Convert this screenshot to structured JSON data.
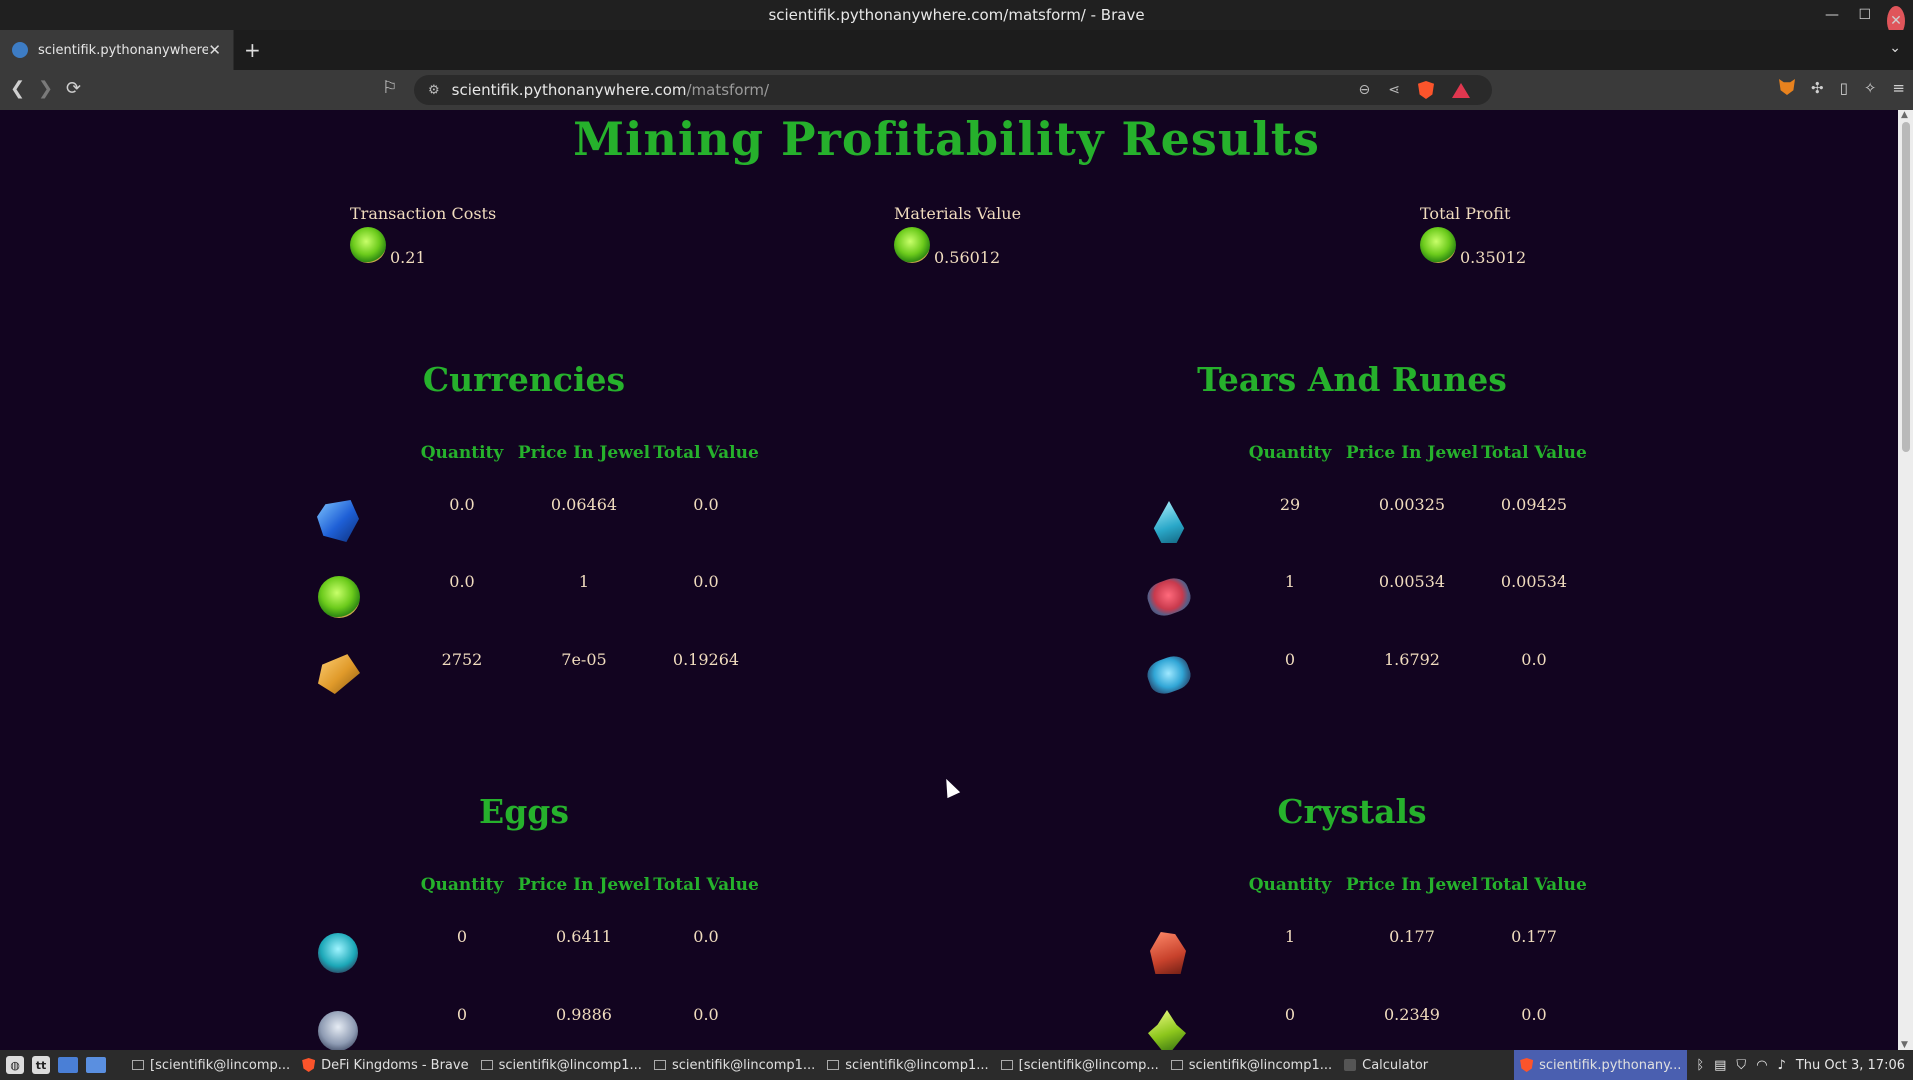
{
  "window": {
    "title": "scientifik.pythonanywhere.com/matsform/ - Brave",
    "min": "—",
    "max": "☐",
    "close": "✕"
  },
  "tabs": [
    {
      "title": "scientifik.pythonanywhere.c",
      "close": "✕"
    }
  ],
  "tabstrip": {
    "new_tab": "+",
    "menu": "⌄"
  },
  "toolbar": {
    "back": "❮",
    "forward": "❯",
    "reload": "⟳",
    "bookmark": "⚐",
    "site_info": "⚙",
    "url_host": "scientifik.pythonanywhere.com",
    "url_path": "/matsform/",
    "zoom": "⊖",
    "share": "⋖",
    "sidebar": "▯",
    "leo": "✧",
    "menu": "≡",
    "extensions": "✣"
  },
  "page": {
    "title": "Mining Profitability Results",
    "summary": [
      {
        "label": "Transaction Costs",
        "value": "0.21"
      },
      {
        "label": "Materials Value",
        "value": "0.56012"
      },
      {
        "label": "Total Profit",
        "value": "0.35012"
      }
    ],
    "column_headers": [
      "Quantity",
      "Price In Jewel",
      "Total Value"
    ],
    "sections": [
      {
        "title": "Currencies",
        "rows": [
          {
            "icon": "blue-gem-icon",
            "quantity": "0.0",
            "price": "0.06464",
            "total": "0.0"
          },
          {
            "icon": "jewel-icon",
            "quantity": "0.0",
            "price": "1",
            "total": "0.0"
          },
          {
            "icon": "gold-bar-icon",
            "quantity": "2752",
            "price": "7e-05",
            "total": "0.19264"
          }
        ]
      },
      {
        "title": "Tears And Runes",
        "rows": [
          {
            "icon": "tear-drop-icon",
            "quantity": "29",
            "price": "0.00325",
            "total": "0.09425"
          },
          {
            "icon": "red-rune-icon",
            "quantity": "1",
            "price": "0.00534",
            "total": "0.00534"
          },
          {
            "icon": "blue-rune-icon",
            "quantity": "0",
            "price": "1.6792",
            "total": "0.0"
          }
        ]
      },
      {
        "title": "Eggs",
        "rows": [
          {
            "icon": "teal-egg-icon",
            "quantity": "0",
            "price": "0.6411",
            "total": "0.0"
          },
          {
            "icon": "grey-egg-icon",
            "quantity": "0",
            "price": "0.9886",
            "total": "0.0"
          }
        ]
      },
      {
        "title": "Crystals",
        "rows": [
          {
            "icon": "red-crystal-icon",
            "quantity": "1",
            "price": "0.177",
            "total": "0.177"
          },
          {
            "icon": "green-crystal-icon",
            "quantity": "0",
            "price": "0.2349",
            "total": "0.0"
          }
        ]
      }
    ]
  },
  "taskbar": {
    "tasks": [
      {
        "label": "[scientifik@lincomp...",
        "icon": "terminal-icon",
        "active": false
      },
      {
        "label": "DeFi Kingdoms - Brave",
        "icon": "brave-icon",
        "active": false
      },
      {
        "label": "scientifik@lincomp1...",
        "icon": "terminal-icon",
        "active": false
      },
      {
        "label": "scientifik@lincomp1...",
        "icon": "terminal-icon",
        "active": false
      },
      {
        "label": "scientifik@lincomp1...",
        "icon": "terminal-icon",
        "active": false
      },
      {
        "label": "[scientifik@lincomp...",
        "icon": "terminal-icon",
        "active": false
      },
      {
        "label": "scientifik@lincomp1...",
        "icon": "terminal-icon",
        "active": false
      },
      {
        "label": "Calculator",
        "icon": "calculator-icon",
        "active": false
      },
      {
        "label": "scientifik.pythonany...",
        "icon": "brave-icon",
        "active": true
      }
    ],
    "clock": "Thu Oct 3, 17:06"
  },
  "colors": {
    "page_bg": "#120420",
    "accent_green": "#26b12c",
    "text_cream": "#f0dcbe"
  }
}
